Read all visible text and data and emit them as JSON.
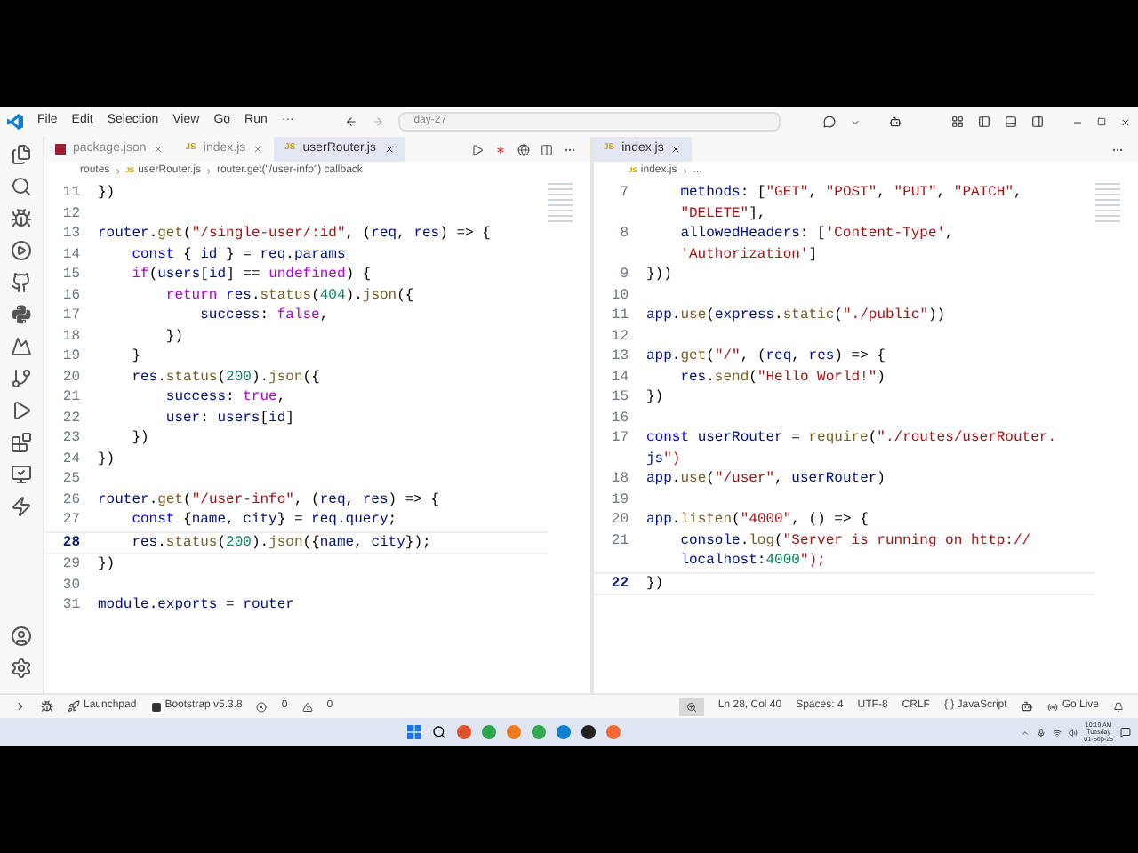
{
  "title_bar": {
    "menu": [
      "File",
      "Edit",
      "Selection",
      "View",
      "Go",
      "Run",
      "···"
    ],
    "search": "day-27"
  },
  "left_editor": {
    "tabs": [
      {
        "label": "package.json",
        "kind": "json",
        "selected": false
      },
      {
        "label": "index.js",
        "kind": "js",
        "badge": "JS",
        "selected": false
      },
      {
        "label": "userRouter.js",
        "kind": "js",
        "badge": "JS",
        "selected": true
      }
    ],
    "breadcrumbs": [
      {
        "label": "routes"
      },
      {
        "label": "userRouter.js",
        "badge": "JS"
      },
      {
        "label": "router.get(\"/user-info\") callback"
      }
    ],
    "lines": [
      {
        "number": "11",
        "text": "})",
        "current": false
      },
      {
        "number": "12",
        "current": false
      },
      {
        "number": "13",
        "text": "router.get(\"/single-user/:id\", (req, res) => {",
        "current": false
      },
      {
        "number": "14",
        "text": "    const { id } = req.params",
        "current": false
      },
      {
        "number": "15",
        "text": "    if(users[id] == undefined) {",
        "current": false
      },
      {
        "number": "16",
        "text": "        return res.status(404).json({",
        "current": false
      },
      {
        "number": "17",
        "text": "            success: false,",
        "current": false
      },
      {
        "number": "18",
        "text": "        })",
        "current": false
      },
      {
        "number": "19",
        "text": "    }",
        "current": false
      },
      {
        "number": "20",
        "text": "    res.status(200).json({",
        "current": false
      },
      {
        "number": "21",
        "text": "        success: true,",
        "current": false
      },
      {
        "number": "22",
        "text": "        user: users[id]",
        "current": false
      },
      {
        "number": "23",
        "text": "    })",
        "current": false
      },
      {
        "number": "24",
        "text": "})",
        "current": false
      },
      {
        "number": "25",
        "current": false
      },
      {
        "number": "26",
        "text": "router.get(\"/user-info\", (req, res) => {",
        "current": false
      },
      {
        "number": "27",
        "text": "    const {name, city} = req.query;",
        "current": false
      },
      {
        "number": "28",
        "text": "    res.status(200).json({name, city});",
        "current": true
      },
      {
        "number": "29",
        "text": "})",
        "current": false
      },
      {
        "number": "30",
        "current": false
      },
      {
        "number": "31",
        "text": "module.exports = router",
        "current": false
      }
    ]
  },
  "right_editor": {
    "tabs": [
      {
        "label": "index.js",
        "kind": "js",
        "badge": "JS",
        "selected": true
      }
    ],
    "breadcrumbs": [
      {
        "label": "index.js",
        "badge": "JS"
      },
      {
        "label": "..."
      }
    ],
    "lines": [
      {
        "number": "7",
        "text": "    methods: [\"GET\", \"POST\", \"PUT\", \"PATCH\",",
        "continuation": "    \"DELETE\"],",
        "current": false
      },
      {
        "number": "8",
        "text": "    allowedHeaders: ['Content-Type',",
        "continuation": "    'Authorization']",
        "current": false
      },
      {
        "number": "9",
        "text": "}))",
        "current": false
      },
      {
        "number": "10",
        "current": false
      },
      {
        "number": "11",
        "text": "app.use(express.static(\"./public\"))",
        "current": false
      },
      {
        "number": "12",
        "current": false
      },
      {
        "number": "13",
        "text": "app.get(\"/\", (req, res) => {",
        "current": false
      },
      {
        "number": "14",
        "text": "    res.send(\"Hello World!\")",
        "current": false
      },
      {
        "number": "15",
        "text": "})",
        "current": false
      },
      {
        "number": "16",
        "current": false
      },
      {
        "number": "17",
        "text": "const userRouter = require(\"./routes/userRouter.",
        "continuation": "js\")",
        "current": false
      },
      {
        "number": "18",
        "text": "app.use(\"/user\", userRouter)",
        "current": false
      },
      {
        "number": "19",
        "current": false
      },
      {
        "number": "20",
        "text": "app.listen(\"4000\", () => {",
        "current": false
      },
      {
        "number": "21",
        "text": "    console.log(\"Server is running on http://",
        "continuation": "    localhost:4000\");",
        "current": false
      },
      {
        "number": "22",
        "text": "})",
        "current": true
      }
    ]
  },
  "status_bar": {
    "left": [
      {
        "kind": "launchpad",
        "text": "Launchpad"
      },
      {
        "kind": "bootstrap",
        "text": "Bootstrap v5.3.8"
      }
    ],
    "problems": {
      "errors": "0",
      "warnings": "0"
    },
    "right": [
      {
        "kind": "zoom"
      },
      {
        "kind": "text",
        "text": "Ln 28, Col 40"
      },
      {
        "kind": "text",
        "text": "Spaces: 4"
      },
      {
        "kind": "text",
        "text": "UTF-8"
      },
      {
        "kind": "text",
        "text": "CRLF"
      },
      {
        "kind": "text",
        "text": "{ } JavaScript"
      },
      {
        "kind": "copilot"
      },
      {
        "kind": "live",
        "text": "Go Live"
      },
      {
        "kind": "bell"
      }
    ]
  },
  "taskbar": {
    "clock": [
      "10:19 AM",
      "Tuesday",
      "01-Sep-25"
    ]
  }
}
